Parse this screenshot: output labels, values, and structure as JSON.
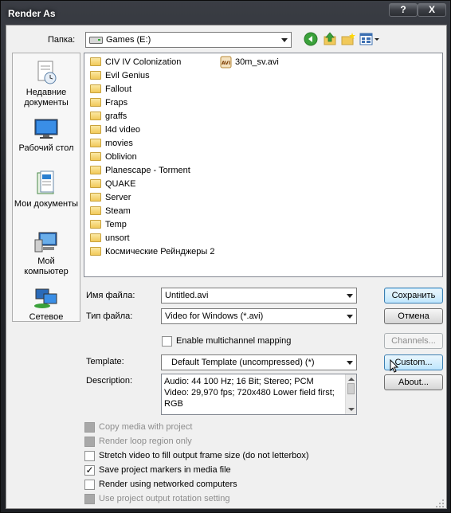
{
  "window": {
    "title": "Render As",
    "help_glyph": "?",
    "close_glyph": "X"
  },
  "location": {
    "label": "Папка:",
    "value": "Games (E:)"
  },
  "places": [
    {
      "label_line1": "Недавние",
      "label_line2": "документы"
    },
    {
      "label_line1": "Рабочий стол",
      "label_line2": ""
    },
    {
      "label_line1": "Мои документы",
      "label_line2": ""
    },
    {
      "label_line1": "Мой",
      "label_line2": "компьютер"
    },
    {
      "label_line1": "Сетевое",
      "label_line2": ""
    }
  ],
  "folders": [
    "CIV IV Colonization",
    "Evil Genius",
    "Fallout",
    "Fraps",
    "graffs",
    "l4d video",
    "movies",
    "Oblivion",
    "Planescape - Torment",
    "QUAKE",
    "Server",
    "Steam",
    "Temp",
    "unsort",
    "Космические Рейнджеры 2"
  ],
  "files": [
    {
      "name": "30m_sv.avi",
      "icon_text": "AVI"
    }
  ],
  "filename": {
    "label": "Имя файла:",
    "value": "Untitled.avi"
  },
  "filetype": {
    "label": "Тип файла:",
    "value": "Video for Windows (*.avi)"
  },
  "multichannel": {
    "label": "Enable multichannel mapping",
    "checked": false
  },
  "template": {
    "label": "Template:",
    "value": "Default Template (uncompressed) (*)"
  },
  "description": {
    "label": "Description:",
    "line1": "Audio: 44 100 Hz; 16 Bit; Stereo; PCM",
    "line2": "Video: 29,970 fps; 720x480 Lower field first;",
    "line3": "RGB"
  },
  "buttons": {
    "save": "Сохранить",
    "cancel": "Отмена",
    "channels": "Channels...",
    "custom": "Custom...",
    "about": "About..."
  },
  "options": [
    {
      "label": "Copy media with project",
      "checked": false,
      "enabled": false
    },
    {
      "label": "Render loop region only",
      "checked": false,
      "enabled": false
    },
    {
      "label": "Stretch video to fill output frame size (do not letterbox)",
      "checked": false,
      "enabled": true
    },
    {
      "label": "Save project markers in media file",
      "checked": true,
      "enabled": true
    },
    {
      "label": "Render using networked computers",
      "checked": false,
      "enabled": true
    },
    {
      "label": "Use project output rotation setting",
      "checked": false,
      "enabled": false
    }
  ],
  "check_glyph": "✓",
  "colors": {
    "accent": "#3c7fb1",
    "folder": "#f1c95a"
  }
}
